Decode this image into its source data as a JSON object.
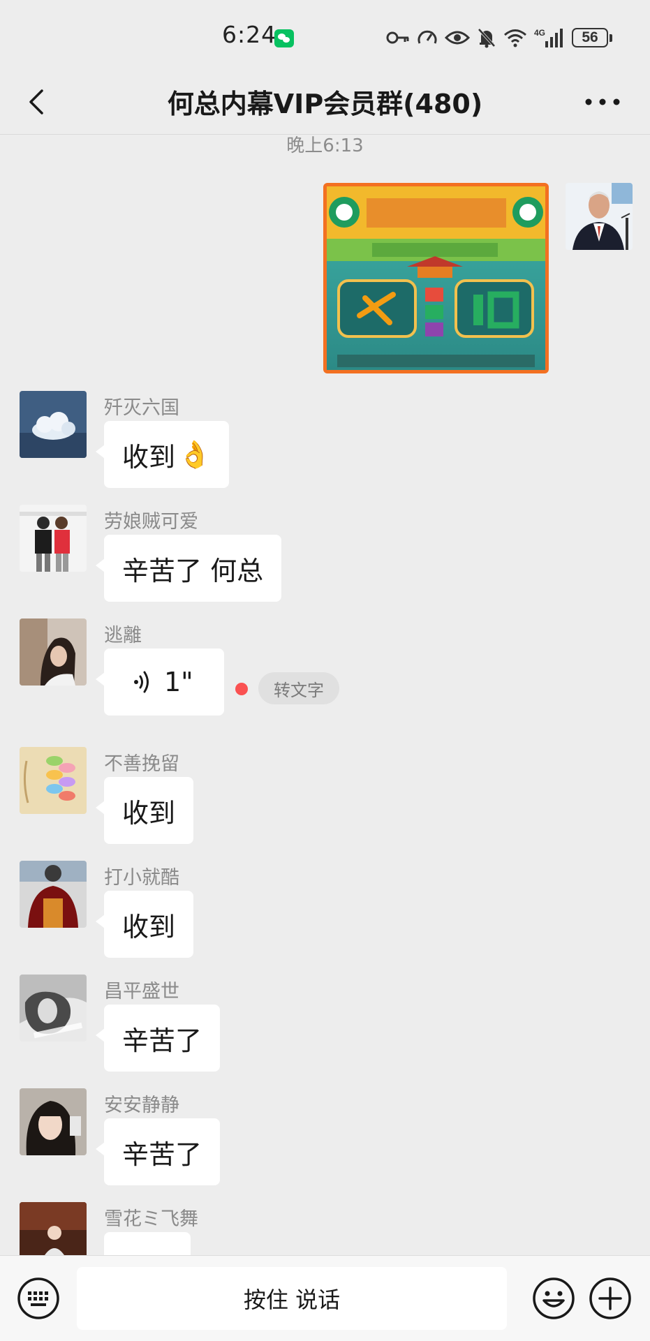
{
  "status_bar": {
    "time": "6:24",
    "battery": "56",
    "network": "4G",
    "icons": [
      "wechat-notification-icon",
      "key-icon",
      "speedometer-icon",
      "eye-icon",
      "mute-bell-icon",
      "wifi-icon",
      "signal-icon",
      "battery-icon"
    ]
  },
  "nav": {
    "title": "何总内幕VIP会员群(480)",
    "back_icon": "chevron-left-icon",
    "more_icon": "more-dots-icon"
  },
  "chat": {
    "time_divider": "晚上6:13",
    "self_message": {
      "type": "image",
      "description_icon": "lottery-poster-image"
    },
    "messages": [
      {
        "sender": "歼灭六国",
        "text": "收到",
        "emoji": "👌"
      },
      {
        "sender": "劳娘贼可爱",
        "text": "辛苦了 何总"
      },
      {
        "sender": "逃離",
        "type": "voice",
        "duration": "1\"",
        "convert_label": "转文字"
      },
      {
        "sender": "不善挽留",
        "text": "收到"
      },
      {
        "sender": "打小就酷",
        "text": "收到"
      },
      {
        "sender": "昌平盛世",
        "text": "辛苦了"
      },
      {
        "sender": "安安静静",
        "text": "辛苦了"
      },
      {
        "sender": "雪花ミ飞舞",
        "text": ""
      }
    ]
  },
  "input_bar": {
    "hold_to_talk": "按住 说话",
    "keyboard_icon": "keyboard-icon",
    "emoji_icon": "emoji-icon",
    "plus_icon": "plus-circle-icon"
  },
  "colors": {
    "background": "#ededed",
    "bubble": "#ffffff",
    "accent_green": "#07c160",
    "unread_dot": "#fa5151"
  }
}
